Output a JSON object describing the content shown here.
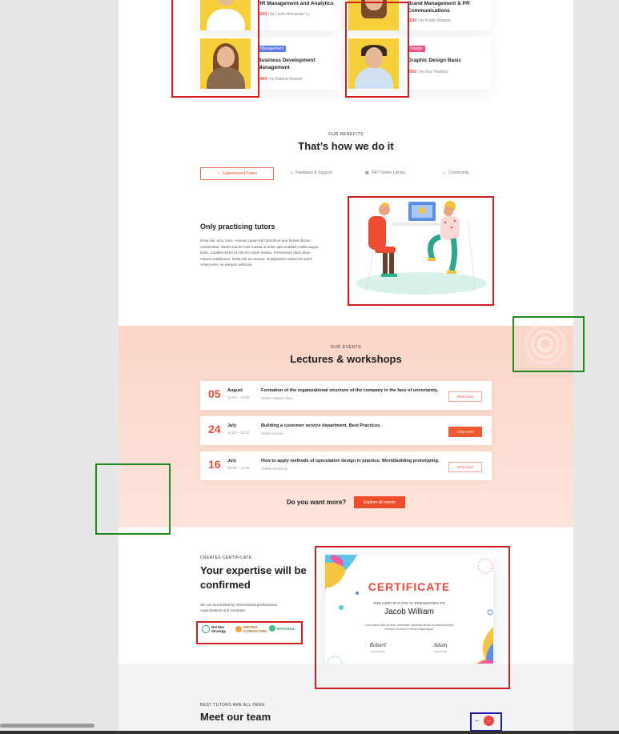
{
  "courses": [
    {
      "title": "HR Management and Analytics",
      "price": "$200",
      "author": "by Leslie Alexander Li."
    },
    {
      "title": "Brand Management & PR Communications",
      "price": "$530",
      "author": "by Kristin Watson"
    },
    {
      "tag": "Management",
      "tag_color": "#5b7cf0",
      "title": "Business Development Management",
      "price": "$400",
      "author": "by Dianne Russell"
    },
    {
      "tag": "Design",
      "tag_color": "#ec4f8a",
      "title": "Graphic Design Basic",
      "price": "$500",
      "author": "by Guy Hawkins"
    }
  ],
  "benefits": {
    "eyebrow": "OUR BENEFITS",
    "heading": "That’s how we do it",
    "tabs": [
      {
        "icon": "☆",
        "label": "Experienced Tutors"
      },
      {
        "icon": "▭",
        "label": "Feedback & Support"
      },
      {
        "icon": "▦",
        "label": "24/7 Online Library"
      },
      {
        "icon": "☺",
        "label": "Community"
      }
    ],
    "active_title": "Only practicing tutors",
    "active_body": "Urna nisi, arcu nunc. Aenean quam est lobortis et aue fames dictum consectetur. Morbi mauris cras massa ut dolor quis sodales mollis augue. Nunc, sodales tortor id nisl orci amet massa. Fermentum diam diam mauris vestibulum. Nulla nisl accumsan, id dignissim massa sit amet. Amet enim, eu tempus vehicula."
  },
  "events": {
    "eyebrow": "OUR EVENTS",
    "heading": "Lectures & workshops",
    "items": [
      {
        "day": "05",
        "month": "August",
        "time": "11:00 – 14:00",
        "title": "Formation of the organizational structure of the company in the face of uncertainty.",
        "place": "Online master-class",
        "button": "View more"
      },
      {
        "day": "24",
        "month": "July",
        "time": "11:00 – 12:30",
        "title": "Building a customer service department. Best Practices.",
        "place": "Online lecture",
        "button": "View more"
      },
      {
        "day": "16",
        "month": "July",
        "time": "10:00 – 13:00",
        "title": "How to apply methods of speculative design in practice. Worldbuilding prototyping.",
        "place": "Online workshop",
        "button": "View more"
      }
    ],
    "more_text": "Do you want more?",
    "more_button": "Explore all events"
  },
  "certificate": {
    "eyebrow": "CREATEX CERTIFICATE",
    "heading": "Your expertise will be confirmed",
    "description": "We are accredited by international professional organizations and institutes:",
    "logos": [
      "Del Mar Strategy",
      "ERITRIA CONSULTING",
      "NATIONAL"
    ],
    "card_title": "CERTIFICATE",
    "card_sub": "THE CERTIFICATE IS PRESENTED TO",
    "card_name": "Jacob William",
    "card_text": "Lorem ipsum dolor sit amet, consectetur adipiscing elit sed do eiusmod tempor incididunt ut labore et dolore magna aliqua.",
    "sign_left": "Robert",
    "sign_left_name": "Robert Smith",
    "sign_right": "Adam",
    "sign_right_name": "Adam Smith"
  },
  "team": {
    "eyebrow": "BEST TUTORS ARE ALL HERE",
    "heading": "Meet our team",
    "prev": "←",
    "next": "→"
  },
  "colors": {
    "accent": "#e84c3d",
    "button": "#ef4e2b",
    "events_bg": "#fbd5c7"
  }
}
